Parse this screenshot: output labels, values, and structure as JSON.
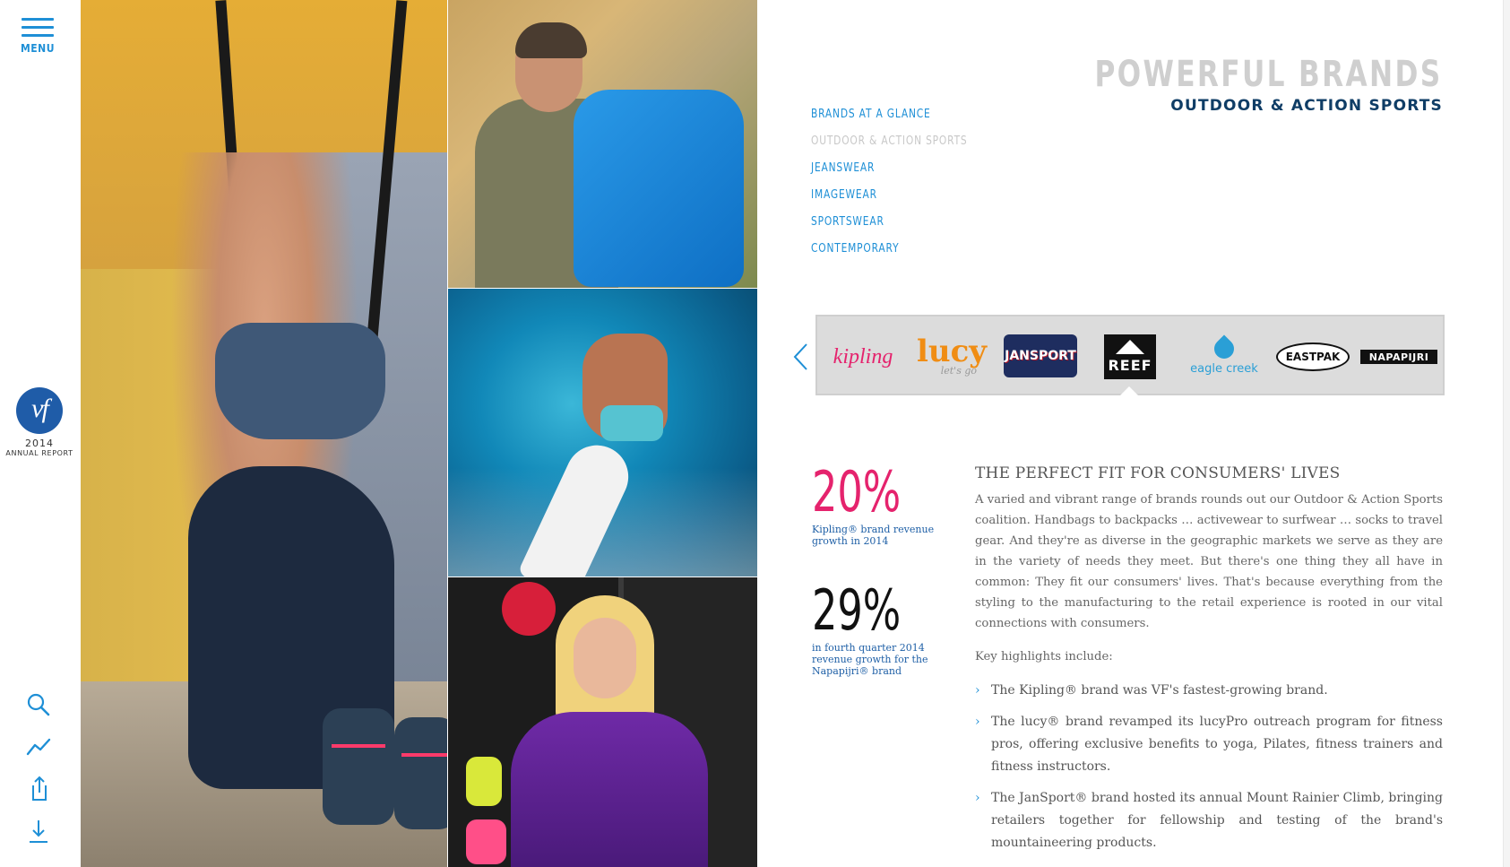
{
  "rail": {
    "menu_label": "MENU",
    "logo_text": "vf",
    "year": "2014",
    "report_label": "ANNUAL REPORT",
    "icons": [
      "search-icon",
      "chart-icon",
      "share-icon",
      "download-icon"
    ]
  },
  "header": {
    "title": "POWERFUL BRANDS",
    "subtitle": "OUTDOOR & ACTION SPORTS"
  },
  "subnav": {
    "items": [
      {
        "label": "BRANDS AT A GLANCE",
        "active": false
      },
      {
        "label": "OUTDOOR & ACTION SPORTS",
        "active": true
      },
      {
        "label": "JEANSWEAR",
        "active": false
      },
      {
        "label": "IMAGEWEAR",
        "active": false
      },
      {
        "label": "SPORTSWEAR",
        "active": false
      },
      {
        "label": "CONTEMPORARY",
        "active": false
      }
    ]
  },
  "brands": {
    "kipling": "kipling",
    "lucy": "lucy",
    "lucy_tag": "let's go",
    "jansport": "JANSPORT",
    "reef": "REEF",
    "eagle": "eagle creek",
    "eastpak": "EASTPAK",
    "napapijri": "NAPAPIJRI",
    "selected": "REEF"
  },
  "stats": [
    {
      "value": "20%",
      "caption": "Kipling® brand revenue growth in 2014",
      "color": "#e5236d"
    },
    {
      "value": "29%",
      "caption": "in fourth quarter 2014 revenue growth for the Napapijri® brand",
      "color": "#111111"
    }
  ],
  "article": {
    "title": "THE PERFECT FIT FOR CONSUMERS' LIVES",
    "intro": "A varied and vibrant range of brands rounds out our Outdoor & Action Sports coalition. Handbags to backpacks … activewear to surfwear … socks to travel gear. And they're as diverse in the geographic markets we serve as they are in the variety of needs they meet. But there's one thing they all have in common: They fit our consumers' lives. That's because everything from the styling to the manufacturing to the retail experience is rooted in our vital connections with consumers.",
    "key_label": "Key highlights include:",
    "highlights": [
      "The Kipling® brand was VF's fastest-growing brand.",
      "The lucy® brand revamped its lucyPro outreach program for fitness pros, offering exclusive benefits to yoga, Pilates, fitness trainers and fitness instructors.",
      "The JanSport® brand hosted its annual Mount Rainier Climb, bringing retailers together for fellowship and testing of the brand's mountaineering products."
    ]
  },
  "colors": {
    "accent": "#1e8fd6",
    "navy": "#0f3d66",
    "pink": "#e5236d"
  }
}
